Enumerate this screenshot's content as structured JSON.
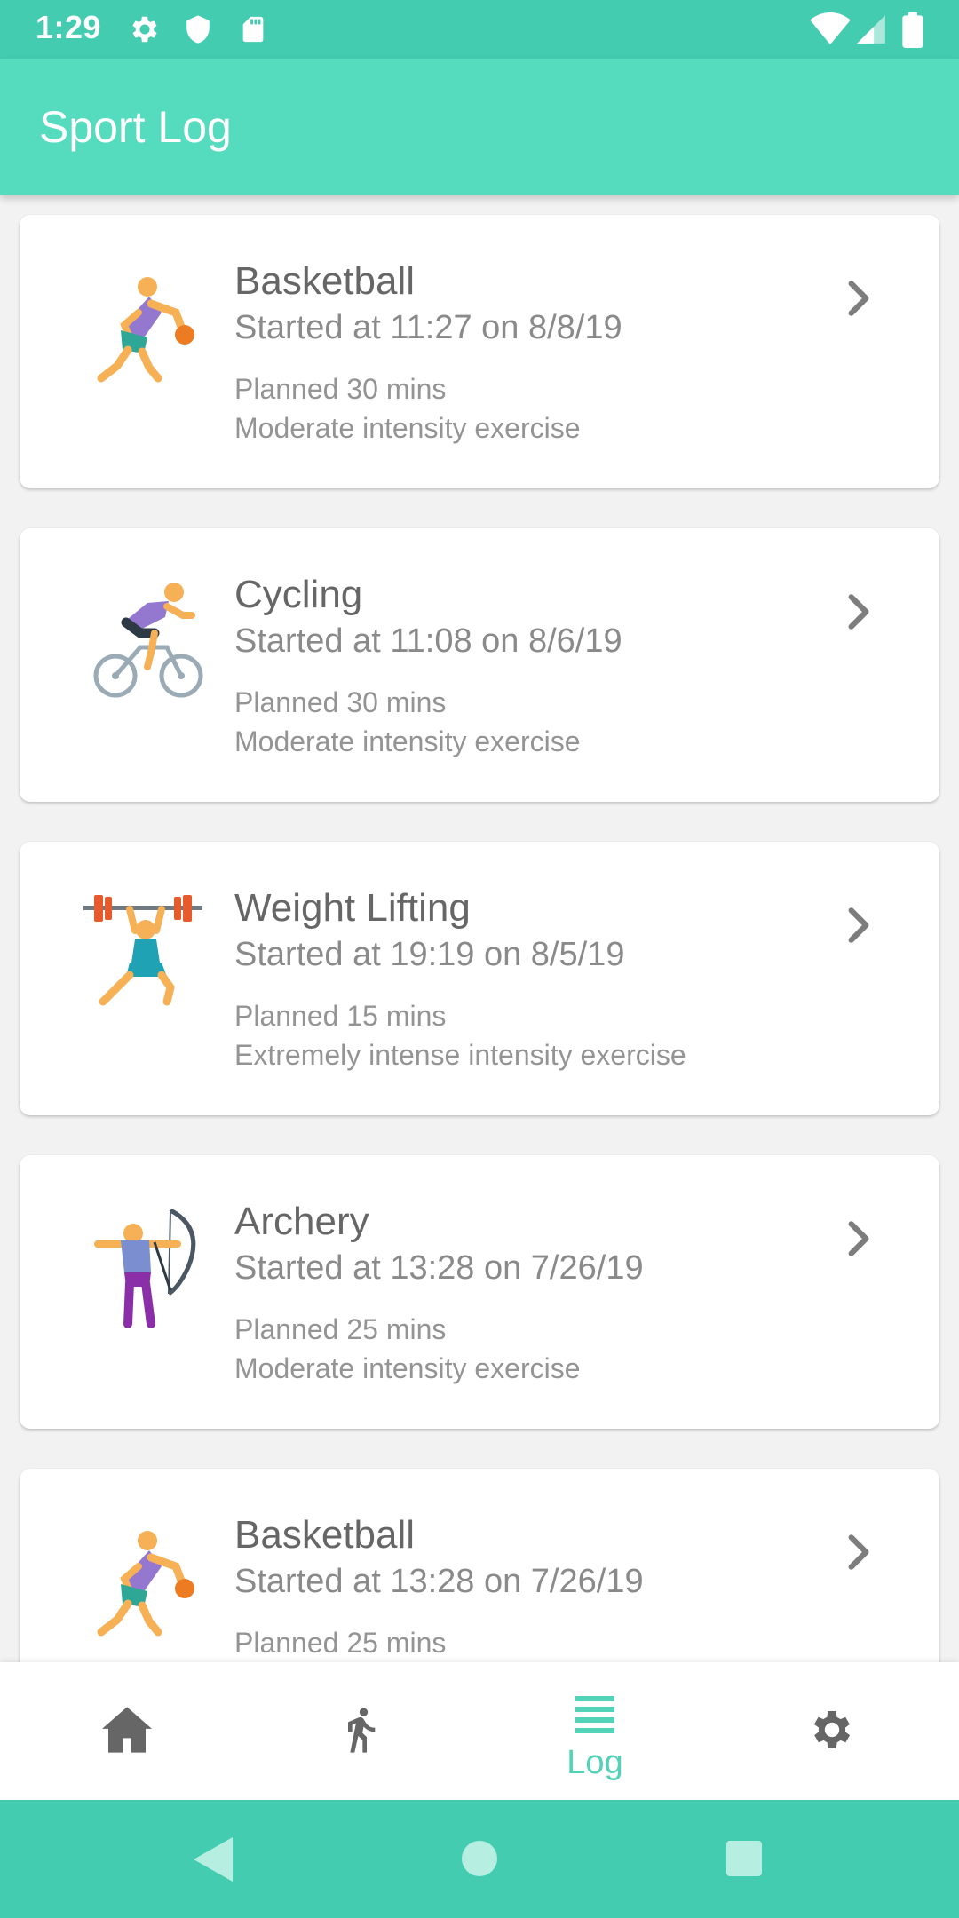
{
  "status": {
    "time": "1:29"
  },
  "app": {
    "title": "Sport Log"
  },
  "logs": [
    {
      "sport": "Basketball",
      "started": "Started at 11:27 on 8/8/19",
      "planned": "Planned 30 mins",
      "intensity": "Moderate intensity exercise",
      "icon": "basketball-player-icon"
    },
    {
      "sport": "Cycling",
      "started": "Started at 11:08 on 8/6/19",
      "planned": "Planned 30 mins",
      "intensity": "Moderate intensity exercise",
      "icon": "cyclist-icon"
    },
    {
      "sport": "Weight Lifting",
      "started": "Started at 19:19 on 8/5/19",
      "planned": "Planned 15 mins",
      "intensity": "Extremely intense intensity exercise",
      "icon": "weightlifter-icon"
    },
    {
      "sport": "Archery",
      "started": "Started at 13:28 on 7/26/19",
      "planned": "Planned 25 mins",
      "intensity": "Moderate intensity exercise",
      "icon": "archer-icon"
    },
    {
      "sport": "Basketball",
      "started": "Started at 13:28 on 7/26/19",
      "planned": "Planned 25 mins",
      "intensity": "",
      "icon": "basketball-player-icon"
    }
  ],
  "nav": {
    "items": [
      {
        "id": "home",
        "icon": "home-icon",
        "label": ""
      },
      {
        "id": "activity",
        "icon": "running-icon",
        "label": ""
      },
      {
        "id": "log",
        "icon": "list-icon",
        "label": "Log",
        "active": true
      },
      {
        "id": "settings",
        "icon": "gear-icon",
        "label": ""
      }
    ]
  },
  "colors": {
    "primary": "#55dbbe",
    "primary_dark": "#44ccb1",
    "active_nav": "#52d2b6",
    "inactive_nav": "#666666"
  }
}
